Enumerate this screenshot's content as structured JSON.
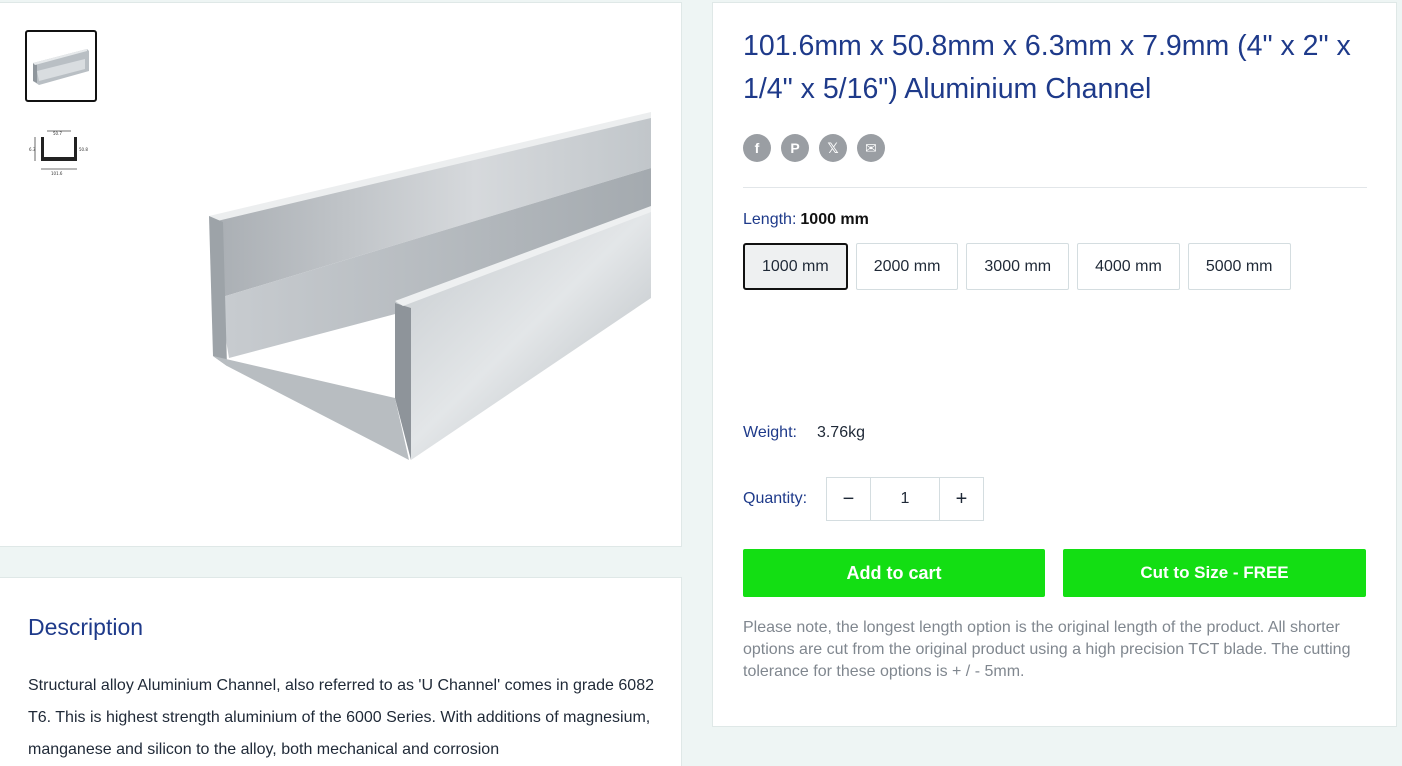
{
  "product": {
    "title": "101.6mm x 50.8mm x 6.3mm x 7.9mm (4\" x 2\" x 1/4\" x 5/16\") Aluminium Channel",
    "share": {
      "facebook": "f",
      "pinterest": "P",
      "twitter": "𝕏",
      "email": "✉"
    },
    "length_label": "Length:",
    "length_selected": "1000 mm",
    "length_options": [
      "1000 mm",
      "2000 mm",
      "3000 mm",
      "4000 mm",
      "5000 mm"
    ],
    "weight_label": "Weight:",
    "weight_value": "3.76kg",
    "quantity_label": "Quantity:",
    "quantity_value": "1",
    "qty_minus": "−",
    "qty_plus": "+",
    "add_to_cart": "Add to cart",
    "cut_to_size": "Cut to Size - FREE",
    "note": "Please note, the longest length option is the original length of the product. All shorter options are cut from the original product using a high precision TCT blade. The cutting tolerance for these options is + / - 5mm."
  },
  "description": {
    "title": "Description",
    "text": "Structural alloy Aluminium Channel, also referred to as 'U Channel' comes in grade 6082 T6. This is highest strength aluminium of the 6000 Series. With additions of magnesium, manganese and silicon to the alloy, both mechanical and corrosion"
  },
  "gallery": {
    "diagram_labels": [
      "50.7",
      "101.6",
      "50.8",
      "6.3"
    ]
  },
  "colors": {
    "accent_green": "#13de13",
    "title_blue": "#1e3a8a",
    "background": "#eef5f4"
  }
}
